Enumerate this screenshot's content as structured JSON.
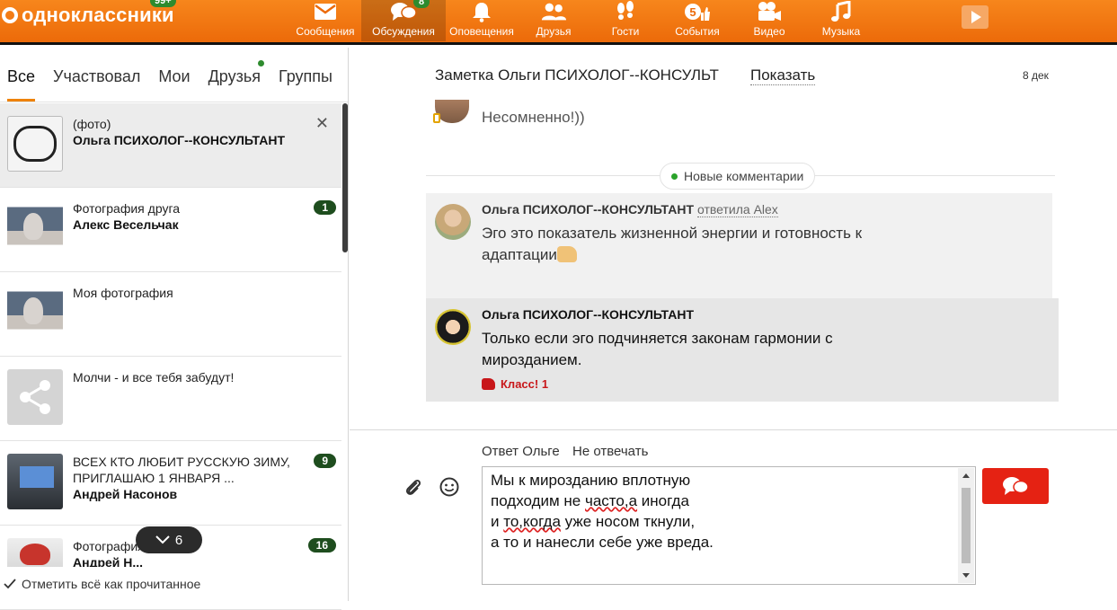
{
  "header": {
    "logo_text": "одноклассники",
    "logo_badge": "99+",
    "nav": [
      {
        "label": "Сообщения",
        "icon": "envelope-icon",
        "badge": ""
      },
      {
        "label": "Обсуждения",
        "icon": "chat-bubbles-icon",
        "badge": "8",
        "active": true
      },
      {
        "label": "Оповещения",
        "icon": "bell-icon",
        "badge": ""
      },
      {
        "label": "Друзья",
        "icon": "friends-icon",
        "badge": ""
      },
      {
        "label": "Гости",
        "icon": "footprints-icon",
        "badge": ""
      },
      {
        "label": "События",
        "icon": "events-icon",
        "badge": "5"
      },
      {
        "label": "Видео",
        "icon": "video-camera-icon",
        "badge": ""
      },
      {
        "label": "Музыка",
        "icon": "music-note-icon",
        "badge": ""
      }
    ]
  },
  "tabs": [
    {
      "label": "Все",
      "active": true
    },
    {
      "label": "Участвовал"
    },
    {
      "label": "Мои"
    },
    {
      "label": "Друзья",
      "dot": true
    },
    {
      "label": "Группы"
    }
  ],
  "discussions": [
    {
      "line1": "(фото)",
      "line2": "Ольга ПСИХОЛОГ--КОНСУЛЬТАНТ",
      "count": "",
      "selected": true
    },
    {
      "line1": "Фотография друга",
      "line2": "Алекс Весельчак",
      "count": "1"
    },
    {
      "line1": "Моя фотография",
      "line2": "",
      "count": ""
    },
    {
      "line1": "Молчи - и все тебя забудут!",
      "line2": "",
      "count": ""
    },
    {
      "line1": "ВСЕХ КТО ЛЮБИТ РУССКУЮ ЗИМУ,  ПРИГЛАШАЮ 1 ЯНВАРЯ ...",
      "line2": "Андрей Насонов",
      "count": "9"
    },
    {
      "line1": "Фотография друга",
      "line2": "Андрей Н...",
      "count": "16"
    }
  ],
  "more_count": "6",
  "mark_read": "Отметить всё как прочитанное",
  "topic": {
    "title": "Заметка Ольги ПСИХОЛОГ--КОНСУЛЬТ",
    "show": "Показать",
    "date": "8 дек"
  },
  "prev_message": "Несомненно!))",
  "new_comments": "Новые комментарии",
  "comments": [
    {
      "author": "Ольга ПСИХОЛОГ--КОНСУЛЬТАНТ",
      "reply": "ответила Alex",
      "text": "Эго это показатель жизненной энергии и готовность к адаптации"
    },
    {
      "author": "Ольга ПСИХОЛОГ--КОНСУЛЬТАНТ",
      "text": "Только если эго  подчиняется законам гармонии с мирозданием.",
      "klass": "Класс! 1"
    }
  ],
  "reply": {
    "to": "Ответ Ольге",
    "no_reply": "Не отвечать",
    "lines": [
      "Мы к мирозданию вплотную",
      "подходим не ",
      "часто,а",
      " иногда",
      "и ",
      "то,когда",
      " уже носом ткнули,",
      "а то и нанесли себе уже вреда."
    ]
  },
  "colors": {
    "accent": "#ee8208",
    "badge_green": "#2e8b2e",
    "send_red": "#e52213",
    "klass_red": "#c8171a"
  }
}
